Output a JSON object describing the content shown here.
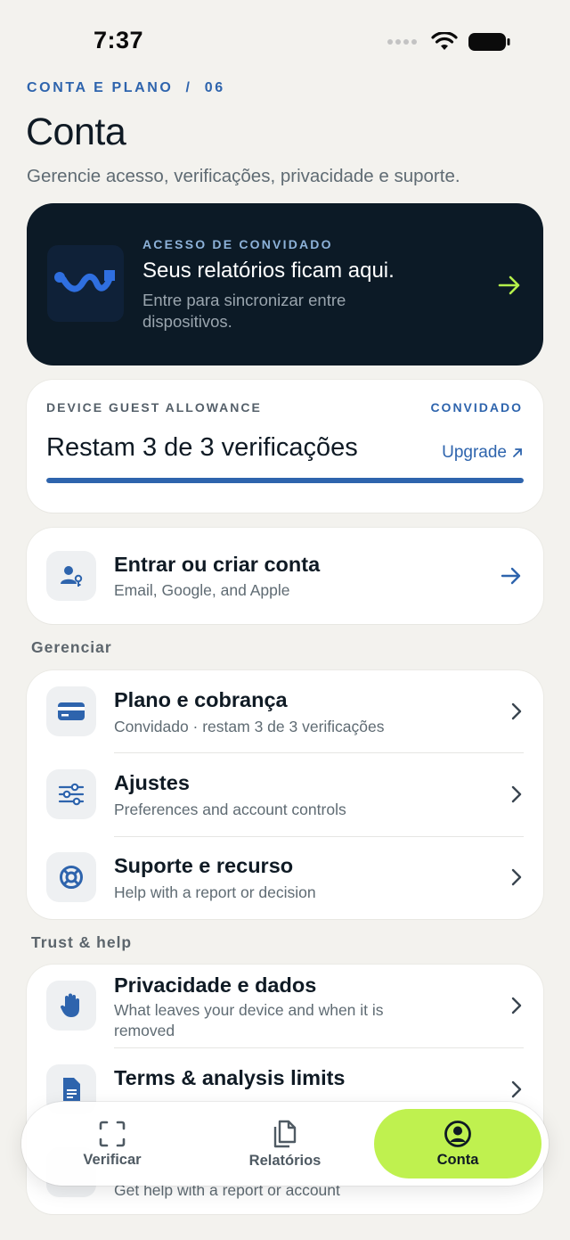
{
  "status_bar": {
    "time": "7:37"
  },
  "header": {
    "breadcrumb": "CONTA E PLANO  /  06",
    "title": "Conta",
    "subtitle": "Gerencie acesso, verificações, privacidade e suporte."
  },
  "hero": {
    "eyebrow": "ACESSO DE CONVIDADO",
    "title": "Seus relatórios ficam aqui.",
    "subtitle": "Entre para sincronizar entre dispositivos.",
    "accent_color": "#b5f04b"
  },
  "allowance": {
    "eyebrow": "DEVICE GUEST ALLOWANCE",
    "badge": "CONVIDADO",
    "count_text": "Restam 3 de 3 verificações",
    "upgrade_label": "Upgrade",
    "progress_fraction": 1.0
  },
  "signin": {
    "title": "Entrar ou criar conta",
    "subtitle": "Email, Google, and Apple"
  },
  "manage": {
    "label": "Gerenciar",
    "items": [
      {
        "title": "Plano e cobrança",
        "subtitle": "Convidado · restam 3 de 3 verificações",
        "icon": "card-icon"
      },
      {
        "title": "Ajustes",
        "subtitle": "Preferences and account controls",
        "icon": "sliders-icon"
      },
      {
        "title": "Suporte e recurso",
        "subtitle": "Help with a report or decision",
        "icon": "lifebuoy-icon"
      }
    ]
  },
  "trust": {
    "label": "Trust & help",
    "items": [
      {
        "title": "Privacidade e dados",
        "subtitle": "What leaves your device and when it is removed",
        "icon": "hand-icon"
      },
      {
        "title": "Terms & analysis limits",
        "subtitle": "",
        "icon": "document-icon"
      },
      {
        "title": "",
        "subtitle": "Get help with a report or account",
        "icon": "help-icon"
      }
    ]
  },
  "tabbar": {
    "tabs": [
      {
        "label": "Verificar",
        "icon": "scan-icon"
      },
      {
        "label": "Relatórios",
        "icon": "documents-icon"
      },
      {
        "label": "Conta",
        "icon": "account-icon"
      }
    ],
    "active_color": "#bff14f"
  }
}
